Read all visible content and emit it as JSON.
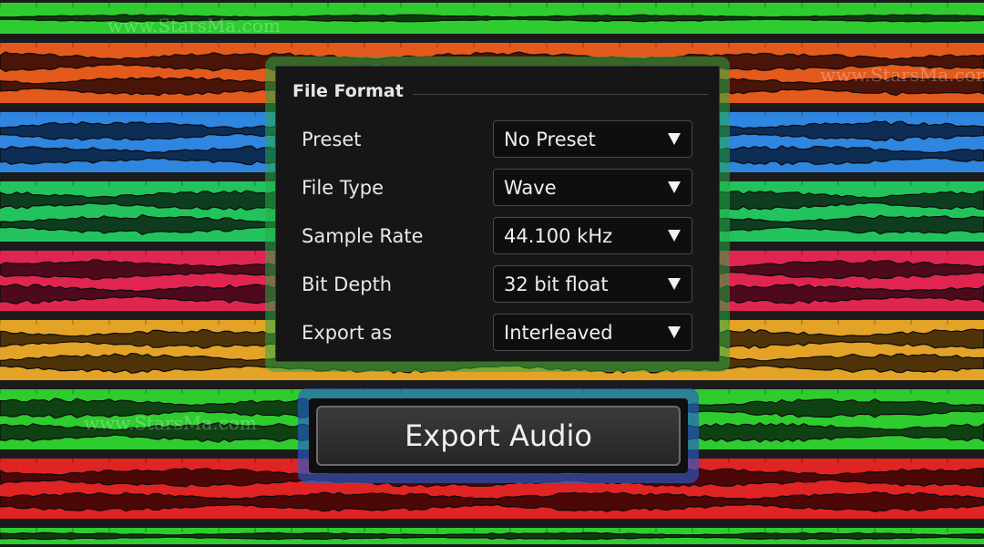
{
  "watermarks": [
    "www.StarsMa.com",
    "www.StarsMa.com",
    "www.StarsMa.com"
  ],
  "file_format": {
    "title": "File Format",
    "rows": [
      {
        "label": "Preset",
        "value": "No Preset"
      },
      {
        "label": "File Type",
        "value": "Wave"
      },
      {
        "label": "Sample Rate",
        "value": "44.100 kHz"
      },
      {
        "label": "Bit Depth",
        "value": "32 bit float"
      },
      {
        "label": "Export as",
        "value": "Interleaved"
      }
    ]
  },
  "export_button": {
    "label": "Export Audio"
  },
  "track_colors": [
    "#2ecc2e",
    "#e35a1c",
    "#2f86e0",
    "#22c35d",
    "#e02650",
    "#e3a327",
    "#2ecc2e",
    "#e02323",
    "#2ecc2e"
  ],
  "waveform_colors": [
    "#0f3a0f",
    "#4a1408",
    "#0d2d55",
    "#0d3d1e",
    "#4d0a1c",
    "#4e3309",
    "#0f4212",
    "#4c0707",
    "#0f3a0f"
  ],
  "icons": {
    "dropdown": "chevron-down-icon"
  }
}
